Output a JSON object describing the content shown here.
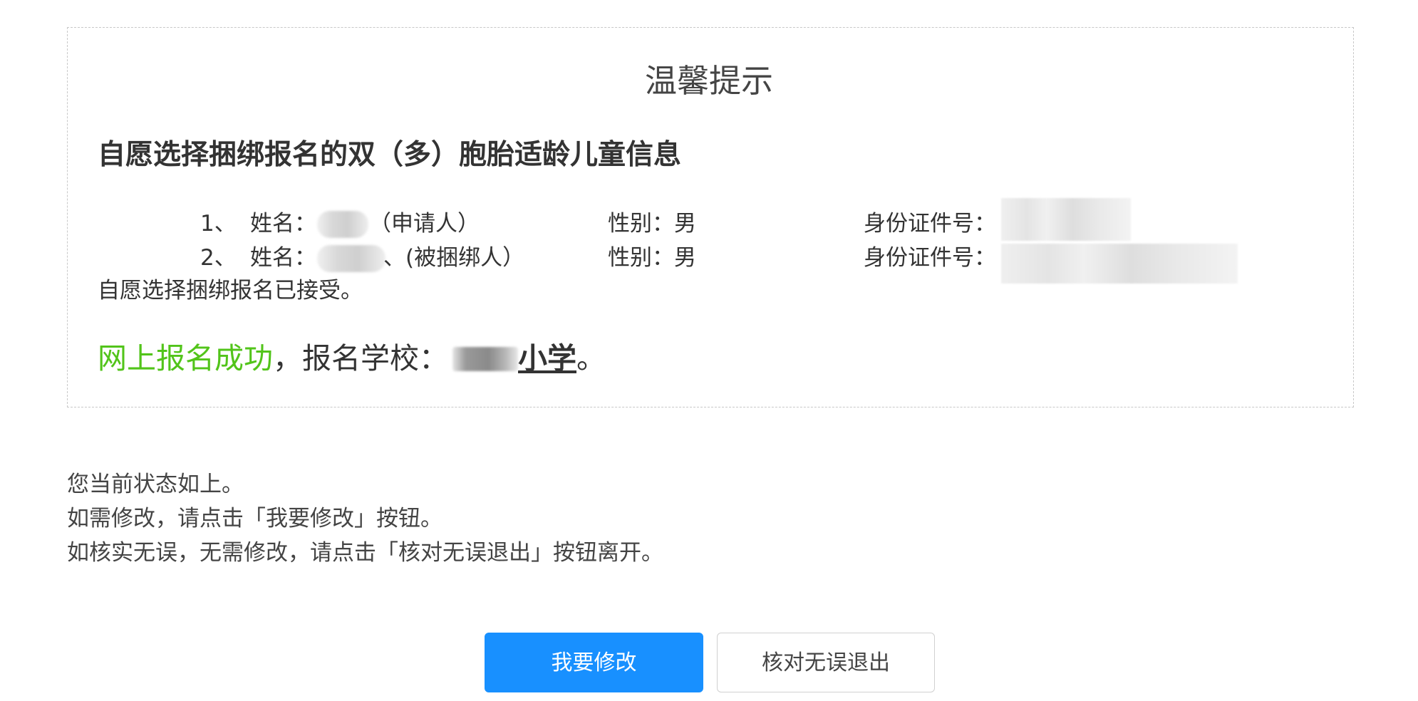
{
  "notice": {
    "title": "温馨提示",
    "heading": "自愿选择捆绑报名的双（多）胞胎适龄儿童信息",
    "children": [
      {
        "index": "1、",
        "name_label": "姓名：",
        "role": "（申请人）",
        "gender": "性别：男",
        "id_label": "身份证件号："
      },
      {
        "index": "2、",
        "name_label": "姓名：",
        "role": "、(被捆绑人）",
        "gender": "性别：男",
        "id_label": "身份证件号："
      }
    ],
    "accepted": "自愿选择捆绑报名已接受。",
    "success": {
      "green_text": "网上报名成功",
      "prefix": "，报名学校：",
      "school_suffix": "小学",
      "end": "。"
    }
  },
  "status_lines": [
    "您当前状态如上。",
    "如需修改，请点击「我要修改」按钮。",
    "如核实无误，无需修改，请点击「核对无误退出」按钮离开。"
  ],
  "buttons": {
    "modify": "我要修改",
    "confirm_exit": "核对无误退出"
  },
  "colors": {
    "primary": "#1890ff",
    "success": "#52c41a",
    "text": "#333333",
    "dashed_border": "#c8c8c8"
  }
}
